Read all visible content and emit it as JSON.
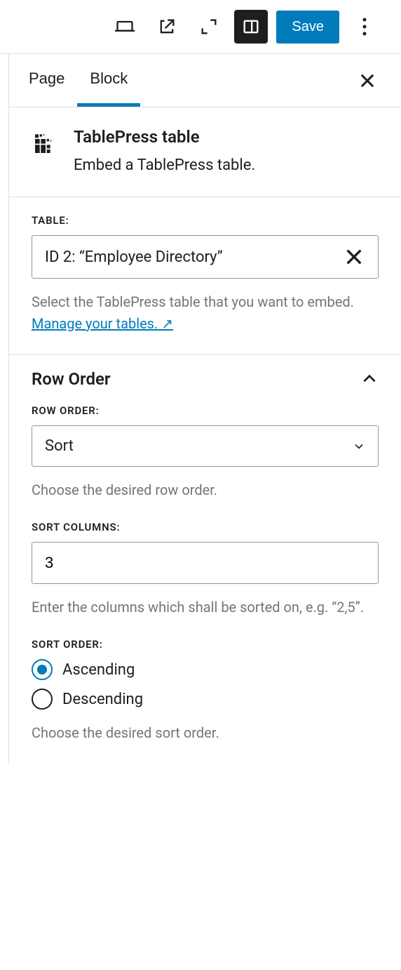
{
  "toolbar": {
    "save_label": "Save"
  },
  "tabs": {
    "page": "Page",
    "block": "Block"
  },
  "block_header": {
    "title": "TablePress table",
    "description": "Embed a TablePress table."
  },
  "table_panel": {
    "label": "TABLE:",
    "selected": "ID 2: “Employee Directory”",
    "help_prefix": "Select the TablePress table that you want to embed. ",
    "manage_link": "Manage your tables.",
    "external_arrow": " ↗"
  },
  "row_order": {
    "section_title": "Row Order",
    "order_label": "ROW ORDER:",
    "order_value": "Sort",
    "order_help": "Choose the desired row order.",
    "columns_label": "SORT COLUMNS:",
    "columns_value": "3",
    "columns_help": "Enter the columns which shall be sorted on, e.g. “2,5”.",
    "sort_order_label": "SORT ORDER:",
    "ascending": "Ascending",
    "descending": "Descending",
    "sort_order_help": "Choose the desired sort order."
  }
}
